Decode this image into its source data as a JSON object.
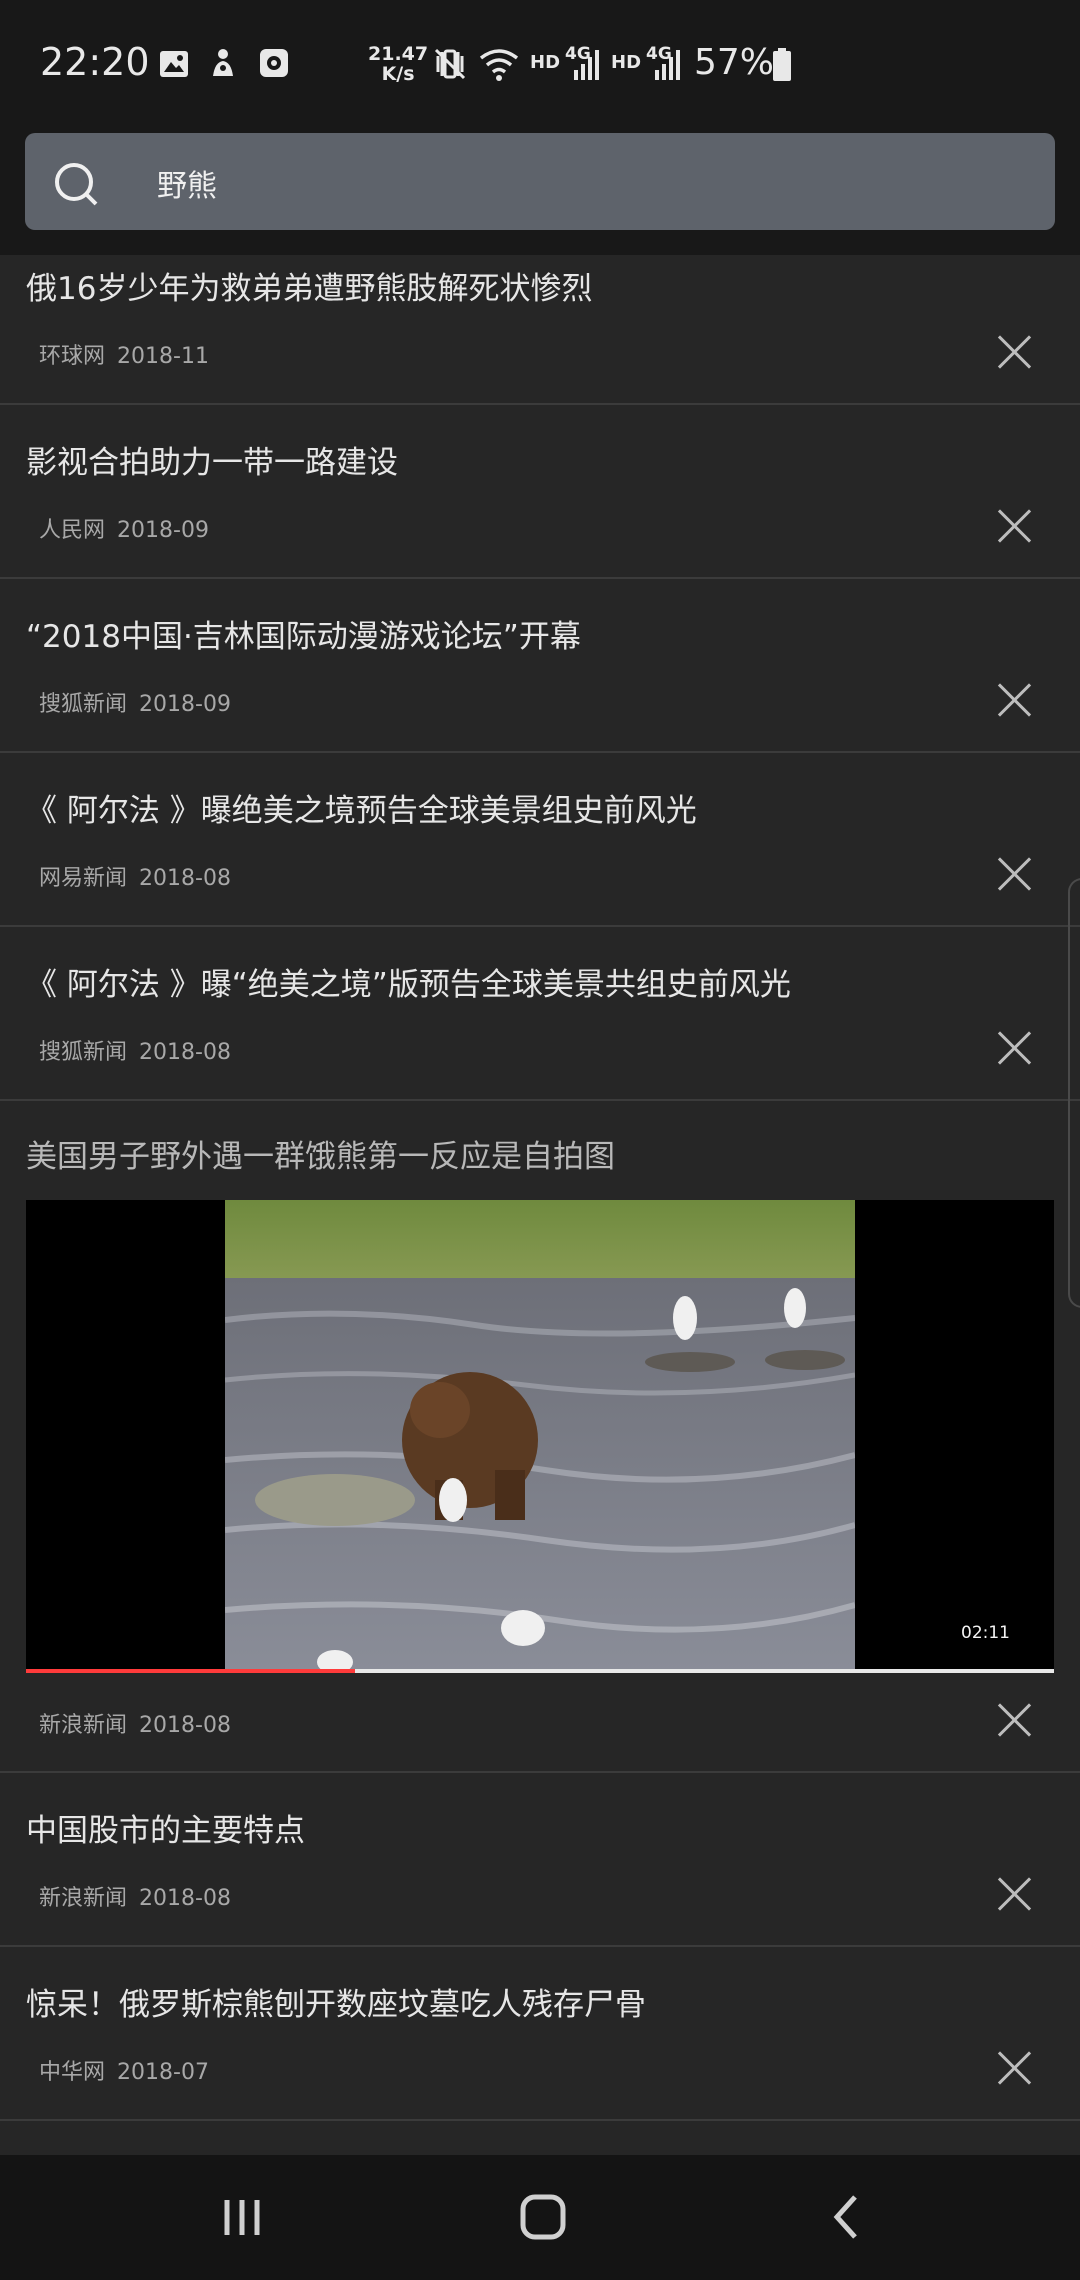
{
  "status_bar": {
    "time": "22:20",
    "net_speed_value": "21.47",
    "net_speed_unit": "K/s",
    "hd1": "HD",
    "net1": "4G",
    "hd2": "HD",
    "net2": "4G",
    "battery_percent": "57%",
    "icons": [
      "image-icon",
      "notification-app-icon",
      "screenshot-app-icon",
      "mute-vibrate-icon",
      "wifi-icon",
      "signal-icon",
      "battery-icon"
    ]
  },
  "search": {
    "query": "野熊",
    "icon": "search-icon"
  },
  "news": [
    {
      "title": "俄16岁少年为救弟弟遭野熊肢解死状惨烈",
      "source": "环球网",
      "date": "2018-11"
    },
    {
      "title": "影视合拍助力一带一路建设",
      "source": "人民网",
      "date": "2018-09"
    },
    {
      "title": "“2018中国·吉林国际动漫游戏论坛”开幕",
      "source": "搜狐新闻",
      "date": "2018-09"
    },
    {
      "title": "《 阿尔法 》曝绝美之境预告全球美景组史前风光",
      "source": "网易新闻",
      "date": "2018-08"
    },
    {
      "title": "《 阿尔法 》曝“绝美之境”版预告全球美景共组史前风光",
      "source": "搜狐新闻",
      "date": "2018-08"
    },
    {
      "title": "美国男子野外遇一群饿熊第一反应是自拍图",
      "source": "新浪新闻",
      "date": "2018-08",
      "video_duration": "02:11",
      "video_progress": 0.32
    },
    {
      "title": "中国股市的主要特点",
      "source": "新浪新闻",
      "date": "2018-08"
    },
    {
      "title": "惊呆！俄罗斯棕熊刨开数座坟墓吃人残存尸骨",
      "source": "中华网",
      "date": "2018-07"
    }
  ],
  "colors": {
    "background": "#262626",
    "search_box": "#5e636b",
    "progress": "#ff3b3b"
  }
}
